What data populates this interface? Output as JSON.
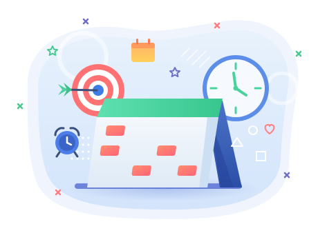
{
  "illustration": {
    "subject": "calendar-scheduling",
    "icons": [
      "calendar-icon",
      "target-icon",
      "arrow-icon",
      "wall-clock-icon",
      "alarm-clock-icon",
      "mini-calendar-icon",
      "star-icon",
      "heart-icon",
      "cross-icon",
      "circle-outline-icon",
      "triangle-outline-icon",
      "square-outline-icon"
    ]
  },
  "colors": {
    "calendar_top": "#48d6a3",
    "calendar_body": "#e9f4fb",
    "calendar_marks": "#ff7a6f",
    "calendar_back": "#3f5fb8",
    "target_ring": "#ff6f72",
    "target_center": "#3f7de6",
    "clock_ring": "#5c8de8",
    "clock_hands": "#4fd09f",
    "alarm_clock": "#4d7ee8",
    "mini_calendar": "#ffc75c",
    "cross_purple": "#6f6ec7",
    "cross_green": "#48c98f",
    "cross_red": "#ff7d7f",
    "background_blob": "#dbe9fb"
  }
}
